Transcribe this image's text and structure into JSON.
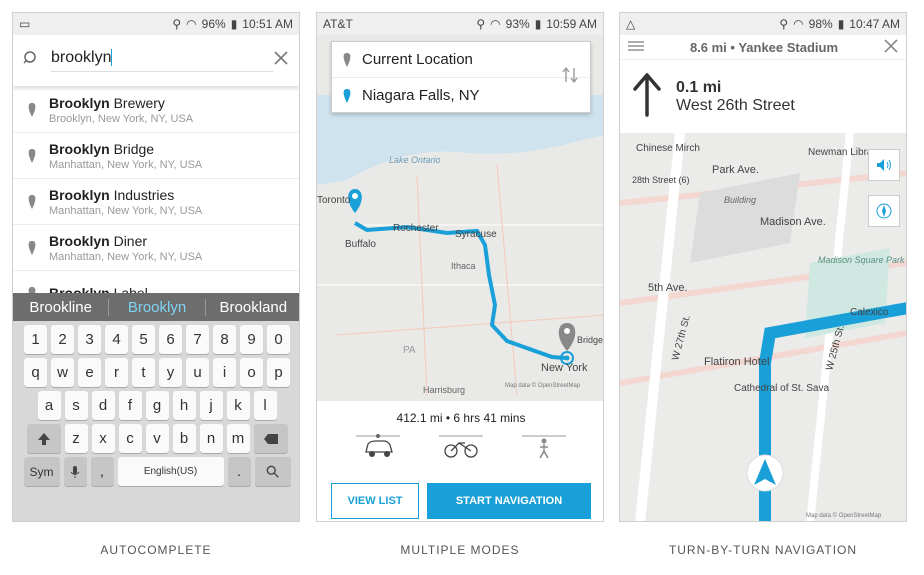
{
  "panels": [
    {
      "caption": "AUTOCOMPLETE",
      "status": {
        "left": "",
        "battery": "96%",
        "time": "10:51 AM"
      },
      "search": {
        "query": "brooklyn"
      },
      "results": [
        {
          "bold": "Brooklyn",
          "rest": " Brewery",
          "sub": "Brooklyn, New York, NY, USA"
        },
        {
          "bold": "Brooklyn",
          "rest": " Bridge",
          "sub": "Manhattan, New York, NY, USA"
        },
        {
          "bold": "Brooklyn",
          "rest": " Industries",
          "sub": "Manhattan, New York, NY, USA"
        },
        {
          "bold": "Brooklyn",
          "rest": " Diner",
          "sub": "Manhattan, New York, NY, USA"
        },
        {
          "bold": "Brooklyn",
          "rest": " Label",
          "sub": ""
        }
      ],
      "suggestions": [
        "Brookline",
        "Brooklyn",
        "Brookland"
      ],
      "keyboard": {
        "row1": [
          "1",
          "2",
          "3",
          "4",
          "5",
          "6",
          "7",
          "8",
          "9",
          "0"
        ],
        "row2": [
          "q",
          "w",
          "e",
          "r",
          "t",
          "y",
          "u",
          "i",
          "o",
          "p"
        ],
        "row3": [
          "a",
          "s",
          "d",
          "f",
          "g",
          "h",
          "j",
          "k",
          "l"
        ],
        "row4": [
          "z",
          "x",
          "c",
          "v",
          "b",
          "n",
          "m"
        ],
        "sym": "Sym",
        "space": "English(US)",
        "comma": ",",
        "period": "."
      }
    },
    {
      "caption": "MULTIPLE MODES",
      "status": {
        "left": "AT&T",
        "battery": "93%",
        "time": "10:59 AM"
      },
      "route": {
        "from": "Current Location",
        "to": "Niagara Falls, NY"
      },
      "map_labels": [
        "Lake Ontario",
        "Toronto",
        "Buffalo",
        "Rochester",
        "Syracuse",
        "Ithaca",
        "PA",
        "New York",
        "Bridge",
        "Harrisburg",
        "Map data © OpenStreetMap"
      ],
      "summary": "412.1 mi • 6 hrs 41 mins",
      "modes": [
        "car-icon",
        "bike-icon",
        "walk-icon"
      ],
      "buttons": {
        "list": "VIEW LIST",
        "start": "START NAVIGATION"
      }
    },
    {
      "caption": "TURN-BY-TURN NAVIGATION",
      "status": {
        "left": "",
        "battery": "98%",
        "time": "10:47 AM"
      },
      "header": {
        "title": "8.6 mi • Yankee Stadium"
      },
      "turn": {
        "distance": "0.1 mi",
        "street": "West 26th Street"
      },
      "map_labels": [
        "Chinese Mirch",
        "28th Street (6)",
        "Park Ave.",
        "Newman Library",
        "Madison Ave.",
        "Madison Square Park",
        "5th Ave.",
        "Calexico",
        "W 27th St.",
        "W 25th St.",
        "Flatiron Hotel",
        "Cathedral of St. Sava",
        "Building",
        "Map data © OpenStreetMap"
      ]
    }
  ]
}
